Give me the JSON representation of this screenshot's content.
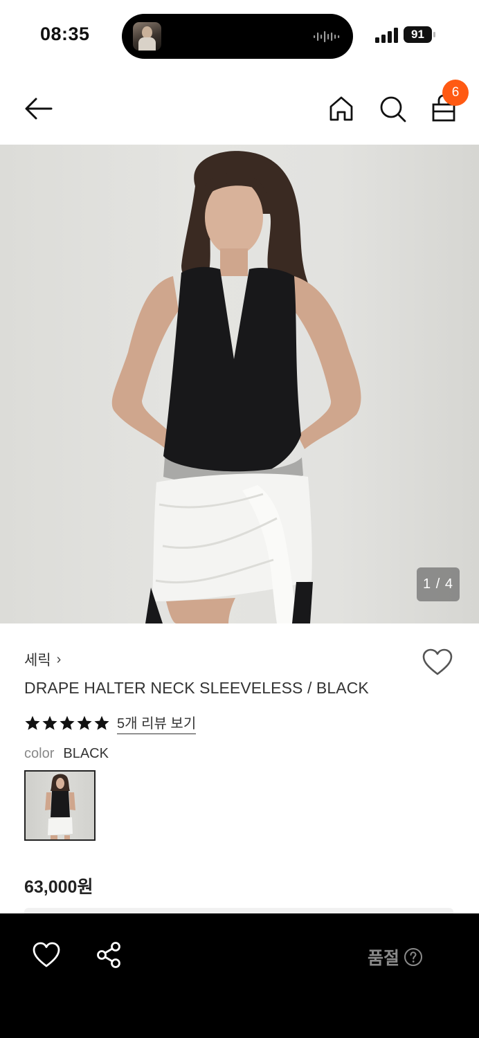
{
  "status_bar": {
    "time": "08:35",
    "battery_level": "91",
    "icons": [
      "now-playing-thumbnail",
      "audio-waveform-icon",
      "cellular-signal-icon",
      "battery-icon"
    ]
  },
  "header": {
    "icons": [
      "back-arrow-icon",
      "home-icon",
      "search-icon",
      "shopping-bag-icon"
    ],
    "cart_count": "6",
    "badge_color": "#ff5a13"
  },
  "gallery": {
    "indicator": "1 / 4",
    "current": 1,
    "total": 4
  },
  "product": {
    "brand": "세릭",
    "brand_chevron": "›",
    "title": "DRAPE HALTER NECK SLEEVELESS / BLACK",
    "rating_stars": 5,
    "review_link": "5개 리뷰 보기",
    "color_label": "color",
    "color_value": "BLACK",
    "price": "63,000원"
  },
  "bottom_bar": {
    "icons": [
      "heart-outline-icon",
      "share-icon",
      "help-circle-icon"
    ],
    "status": "품절"
  }
}
